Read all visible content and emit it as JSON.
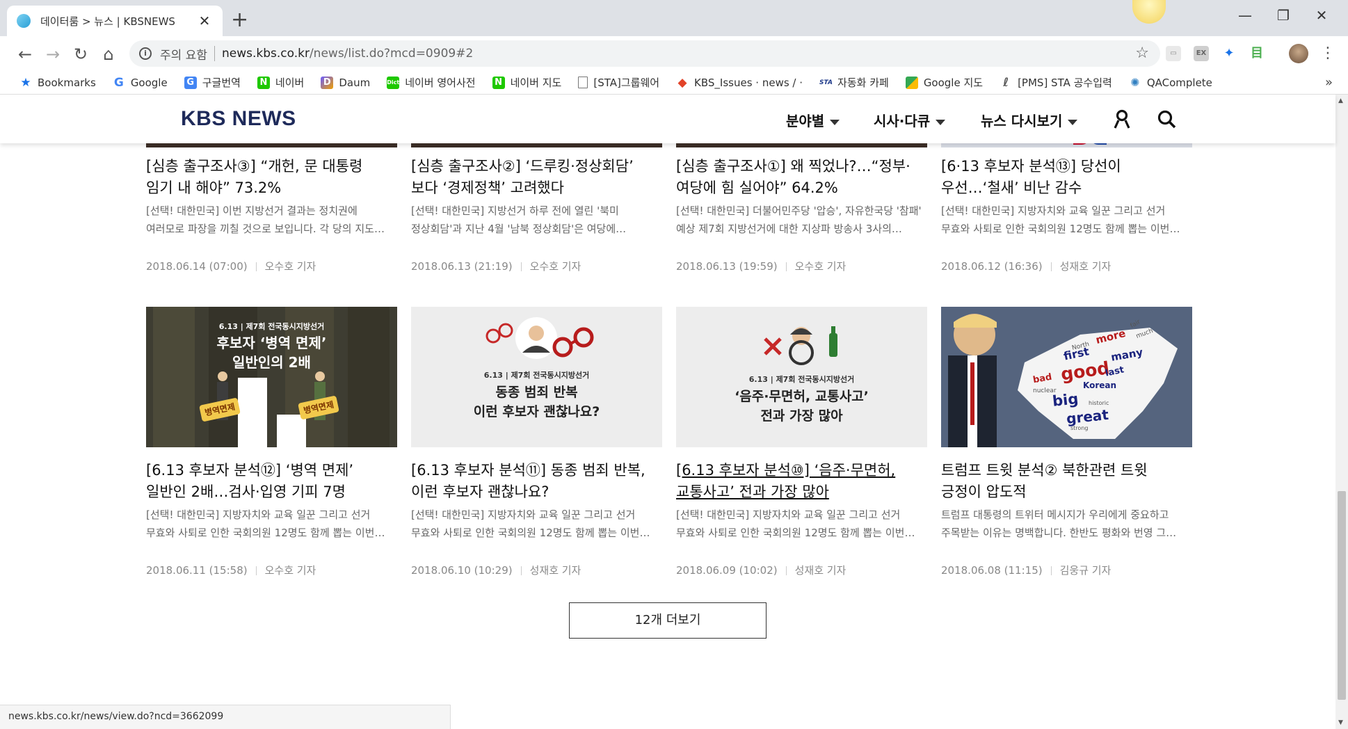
{
  "browser": {
    "tab_title": "데이터룸 > 뉴스 | KBSNEWS",
    "security_warning": "주의 요함",
    "url_host": "news.kbs.co.kr",
    "url_path": "/news/list.do?mcd=0909#2",
    "status_url": "news.kbs.co.kr/news/view.do?ncd=3662099"
  },
  "bookmarks": [
    {
      "label": "Bookmarks",
      "icon": "star-icon"
    },
    {
      "label": "Google",
      "icon": "google-icon"
    },
    {
      "label": "구글번역",
      "icon": "translate-icon"
    },
    {
      "label": "네이버",
      "icon": "naver-icon"
    },
    {
      "label": "Daum",
      "icon": "daum-icon"
    },
    {
      "label": "네이버 영어사전",
      "icon": "dict-icon"
    },
    {
      "label": "네이버 지도",
      "icon": "naver-icon"
    },
    {
      "label": "[STA]그룹웨어",
      "icon": "page-icon"
    },
    {
      "label": "KBS_Issues · news / ·",
      "icon": "gitlab-icon"
    },
    {
      "label": "자동화 카페",
      "icon": "sta-icon"
    },
    {
      "label": "Google 지도",
      "icon": "maps-icon"
    },
    {
      "label": "[PMS] STA 공수입력",
      "icon": "pms-icon"
    },
    {
      "label": "QAComplete",
      "icon": "qa-icon"
    }
  ],
  "site": {
    "logo": "KBS NEWS",
    "nav": [
      "분야별",
      "시사·다큐",
      "뉴스 다시보기"
    ]
  },
  "articles": [
    {
      "title1": "[심층 출구조사③] “개헌, 문 대통령",
      "title2": "임기 내 해야” 73.2%",
      "desc1": "[선택! 대한민국] 이번 지방선거 결과는 정치권에",
      "desc2": "여러모로 파장을 끼칠 것으로 보입니다. 각 당의 지도…",
      "date": "2018.06.14 (07:00)",
      "reporter": "오수호 기자"
    },
    {
      "title1": "[심층 출구조사②] ‘드루킹·정상회담’",
      "title2": "보다 ‘경제정책’ 고려했다",
      "desc1": "[선택! 대한민국] 지방선거 하루 전에 열린 '북미",
      "desc2": "정상회담'과 지난 4월 '남북 정상회담'은 여당에…",
      "date": "2018.06.13 (21:19)",
      "reporter": "오수호 기자"
    },
    {
      "title1": "[심층 출구조사①] 왜 찍었나?…“정부·",
      "title2": "여당에 힘 실어야” 64.2%",
      "desc1": "[선택! 대한민국] 더불어민주당 '압승', 자유한국당 '참패'",
      "desc2": "예상 제7회 지방선거에 대한 지상파 방송사 3사의…",
      "date": "2018.06.13 (19:59)",
      "reporter": "오수호 기자"
    },
    {
      "title1": "[6·13 후보자 분석⑬] 당선이",
      "title2": "우선…‘철새’ 비난 감수",
      "desc1": "[선택! 대한민국] 지방자치와 교육 일꾼 그리고 선거",
      "desc2": "무효와 사퇴로 인한 국회의원 12명도 함께 뽑는 이번…",
      "date": "2018.06.12 (16:36)",
      "reporter": "성재호 기자"
    },
    {
      "title1": "[6.13 후보자 분석⑫] ‘병역 면제’",
      "title2": "일반인 2배…검사·입영 기피 7명",
      "desc1": "[선택! 대한민국] 지방자치와 교육 일꾼 그리고 선거",
      "desc2": "무효와 사퇴로 인한 국회의원 12명도 함께 뽑는 이번…",
      "date": "2018.06.11 (15:58)",
      "reporter": "오수호 기자",
      "thumb": {
        "badge": "6.13 | 제7회 전국동시지방선거",
        "line1": "후보자 ‘병역 면제’",
        "line2": "일반인의 2배",
        "tag": "병역면제"
      }
    },
    {
      "title1": "[6.13 후보자 분석⑪] 동종 범죄 반복,",
      "title2": "이런 후보자 괜찮나요?",
      "desc1": "[선택! 대한민국] 지방자치와 교육 일꾼 그리고 선거",
      "desc2": "무효와 사퇴로 인한 국회의원 12명도 함께 뽑는 이번…",
      "date": "2018.06.10 (10:29)",
      "reporter": "성재호 기자",
      "thumb": {
        "badge": "6.13 | 제7회 전국동시지방선거",
        "line1": "동종 범죄 반복",
        "line2": "이런 후보자 괜찮나요?"
      }
    },
    {
      "title1": "[6.13 후보자 분석⑩] ‘음주·무면허,",
      "title2": "교통사고’ 전과 가장 많아",
      "desc1": "[선택! 대한민국] 지방자치와 교육 일꾼 그리고 선거",
      "desc2": "무효와 사퇴로 인한 국회의원 12명도 함께 뽑는 이번…",
      "date": "2018.06.09 (10:02)",
      "reporter": "성재호 기자",
      "thumb": {
        "badge": "6.13 | 제7회 전국동시지방선거",
        "line1": "‘음주·무면허, 교통사고’",
        "line2": "전과 가장 많아"
      }
    },
    {
      "title1": "트럼프 트윗 분석② 북한관련 트윗",
      "title2": "긍정이 압도적",
      "desc1": "트럼프 대통령의 트위터 메시지가 우리에게 중요하고",
      "desc2": "주목받는 이유는 명백합니다. 한반도 평화와 번영 그…",
      "date": "2018.06.08 (11:15)",
      "reporter": "김웅규 기자",
      "thumb": {
        "words": [
          "more",
          "many",
          "good",
          "first",
          "last",
          "bad",
          "Korean",
          "big",
          "great",
          "North",
          "much",
          "fair",
          "nuclear",
          "historic",
          "strong"
        ]
      }
    }
  ],
  "more_button": "12개 더보기"
}
